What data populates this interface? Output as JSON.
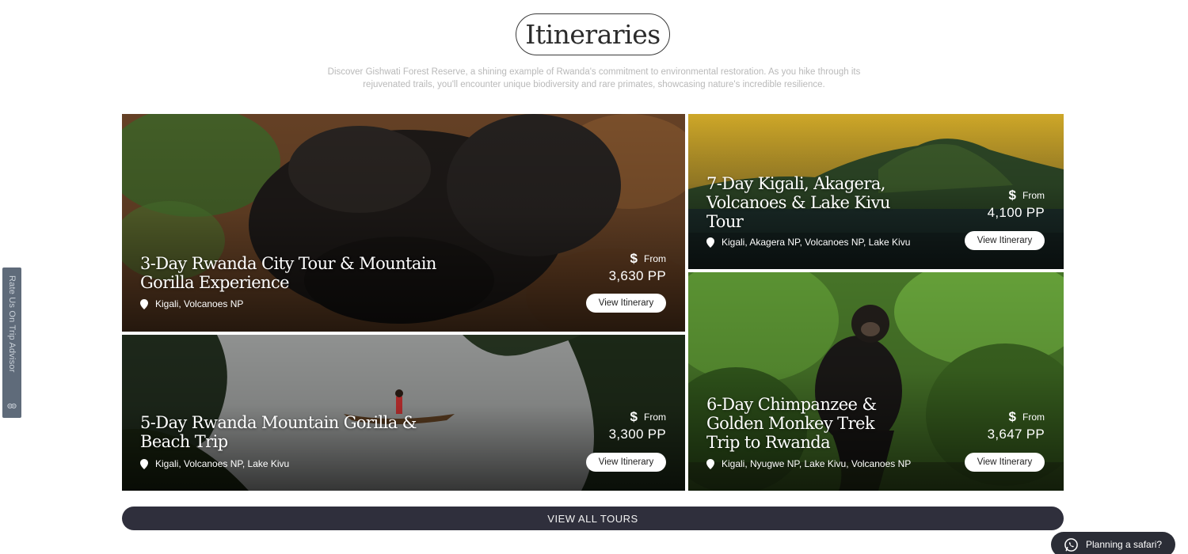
{
  "section": {
    "heading": "Itineraries",
    "intro_line1": "Discover Gishwati Forest Reserve, a shining example of Rwanda's commitment to environmental restoration. As you hike through its",
    "intro_line2": "rejuvenated trails, you'll encounter unique biodiversity and rare primates, showcasing nature's incredible resilience."
  },
  "tours": [
    {
      "title_line1": "3-Day Rwanda City Tour & Mountain",
      "title_line2": "Gorilla Experience",
      "location": "Kigali, Volcanoes NP",
      "currency_symbol": "$",
      "from_label": "From",
      "price": "3,630 PP",
      "button": "View Itinerary"
    },
    {
      "title_line1": "7-Day Kigali, Akagera,",
      "title_line2": "Volcanoes & Lake Kivu",
      "title_line3": "Tour",
      "location": "Kigali, Akagera NP, Volcanoes NP, Lake Kivu",
      "currency_symbol": "$",
      "from_label": "From",
      "price": "4,100 PP",
      "button": "View Itinerary"
    },
    {
      "title_line1": "5-Day Rwanda Mountain Gorilla &",
      "title_line2": "Beach Trip",
      "location": "Kigali, Volcanoes NP, Lake Kivu",
      "currency_symbol": "$",
      "from_label": "From",
      "price": "3,300 PP",
      "button": "View Itinerary"
    },
    {
      "title_line1": "6-Day Chimpanzee &",
      "title_line2": "Golden Monkey Trek",
      "title_line3": "Trip to Rwanda",
      "location": "Kigali, Nyugwe NP, Lake Kivu, Volcanoes NP",
      "currency_symbol": "$",
      "from_label": "From",
      "price": "3,647 PP",
      "button": "View Itinerary"
    }
  ],
  "view_all": "VIEW ALL TOURS",
  "side_tab": {
    "label": "Rate Us On Trip Advisor",
    "icon": "tripadvisor-owl-icon"
  },
  "chat": {
    "label": "Planning a safari?",
    "icon": "whatsapp-icon"
  },
  "colors": {
    "dark_button": "#2f2f3c",
    "chat_bg": "#2b2d36",
    "side_tab": "#5f6b7a",
    "intro_text": "#b9b9b9"
  }
}
